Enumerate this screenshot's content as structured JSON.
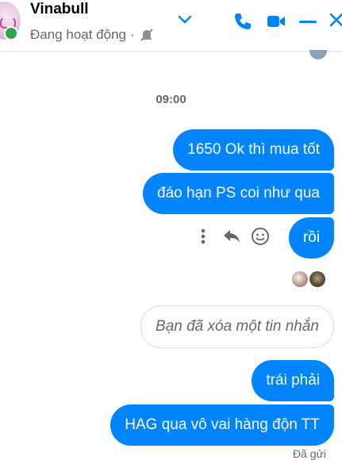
{
  "header": {
    "name": "Vinabull",
    "status": "Đang hoạt động",
    "separator": "·"
  },
  "conversation": {
    "timestamp": "09:00",
    "messages": [
      {
        "text": "1650 Ok thì mua tốt"
      },
      {
        "text": "đáo hạn PS coi như qua"
      },
      {
        "text": "rồi"
      },
      {
        "text": "trái phải"
      },
      {
        "text": "HAG qua vô vai hàng độn TT"
      }
    ],
    "deleted_notice": "Bạn đã xóa một tin nhắn",
    "sent_status": "Đã gửi"
  },
  "colors": {
    "accent": "#0084ff",
    "online": "#31a24c",
    "secondary_text": "#65676b"
  },
  "icons": [
    "mute-icon",
    "chevron-down-icon",
    "phone-icon",
    "video-icon",
    "minimize-icon",
    "close-icon",
    "more-icon",
    "reply-icon",
    "emoji-icon"
  ]
}
